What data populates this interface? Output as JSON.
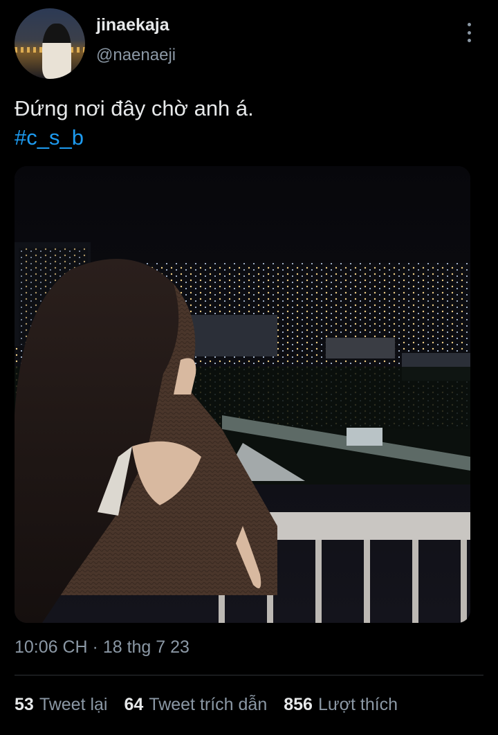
{
  "user": {
    "display_name": "jinaekaja",
    "handle": "@naenaeji"
  },
  "tweet": {
    "text": "Đứng nơi đây chờ anh á.",
    "hashtag": "#c_s_b",
    "timestamp": "10:06 CH · 18 thg 7 23"
  },
  "stats": {
    "retweets_count": "53",
    "retweets_label": "Tweet lại",
    "quotes_count": "64",
    "quotes_label": "Tweet trích dẫn",
    "likes_count": "856",
    "likes_label": "Lượt thích"
  },
  "colors": {
    "background": "#000000",
    "accent": "#1d9bf0",
    "secondary_text": "#8b98a5"
  },
  "icons": [
    "more-vertical-icon"
  ]
}
